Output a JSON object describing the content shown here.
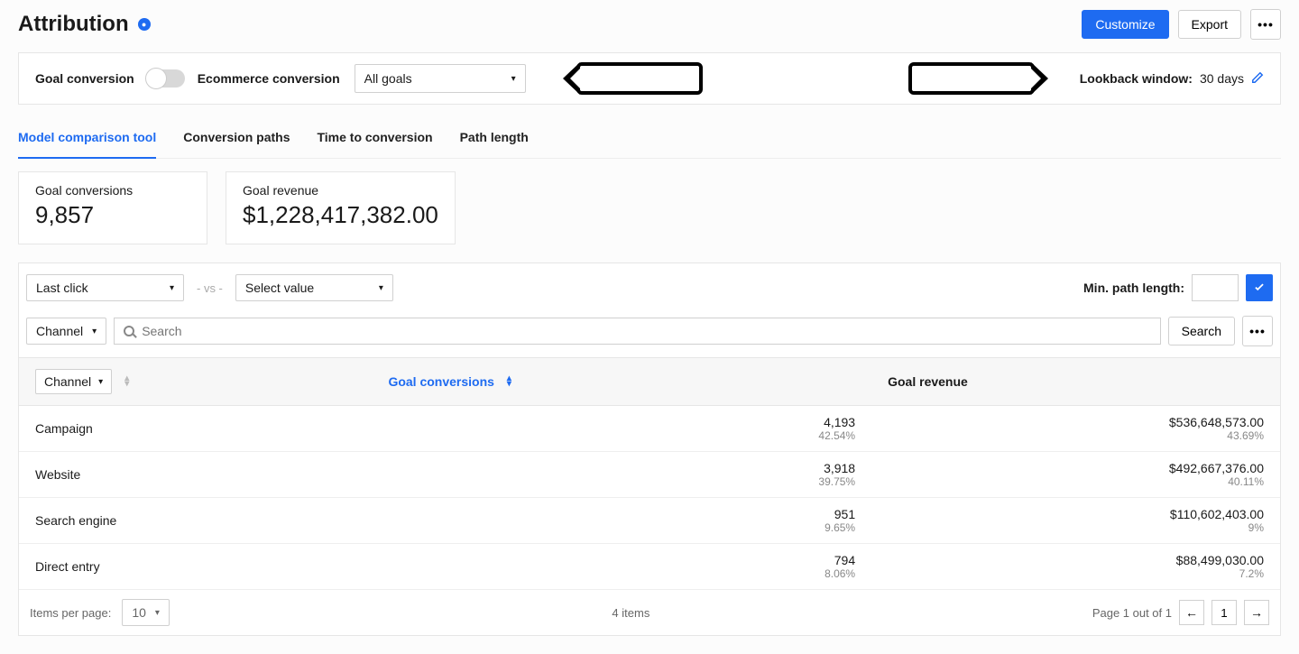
{
  "header": {
    "title": "Attribution",
    "customize_label": "Customize",
    "export_label": "Export"
  },
  "settings": {
    "goal_conversion_label": "Goal conversion",
    "ecommerce_conversion_label": "Ecommerce conversion",
    "goal_select_value": "All goals",
    "lookback_label": "Lookback window:",
    "lookback_value": "30 days"
  },
  "tabs": {
    "model_comparison": "Model comparison tool",
    "conversion_paths": "Conversion paths",
    "time_to_conversion": "Time to conversion",
    "path_length": "Path length"
  },
  "metrics": {
    "goal_conversions_label": "Goal conversions",
    "goal_conversions_value": "9,857",
    "goal_revenue_label": "Goal revenue",
    "goal_revenue_value": "$1,228,417,382.00"
  },
  "controls": {
    "model_a_value": "Last click",
    "vs_text": "-  vs  -",
    "model_b_value": "Select value",
    "min_path_label": "Min. path length:",
    "dimension_value": "Channel",
    "search_placeholder": "Search",
    "search_button": "Search"
  },
  "table": {
    "col_channel": "Channel",
    "col_conversions": "Goal conversions",
    "col_revenue": "Goal revenue",
    "rows": [
      {
        "channel": "Campaign",
        "conversions": "4,193",
        "conv_pct": "42.54%",
        "revenue": "$536,648,573.00",
        "rev_pct": "43.69%"
      },
      {
        "channel": "Website",
        "conversions": "3,918",
        "conv_pct": "39.75%",
        "revenue": "$492,667,376.00",
        "rev_pct": "40.11%"
      },
      {
        "channel": "Search engine",
        "conversions": "951",
        "conv_pct": "9.65%",
        "revenue": "$110,602,403.00",
        "rev_pct": "9%"
      },
      {
        "channel": "Direct entry",
        "conversions": "794",
        "conv_pct": "8.06%",
        "revenue": "$88,499,030.00",
        "rev_pct": "7.2%"
      }
    ]
  },
  "footer": {
    "items_per_page_label": "Items per page:",
    "items_per_page_value": "10",
    "item_count": "4 items",
    "page_info": "Page 1 out of 1",
    "current_page": "1"
  }
}
